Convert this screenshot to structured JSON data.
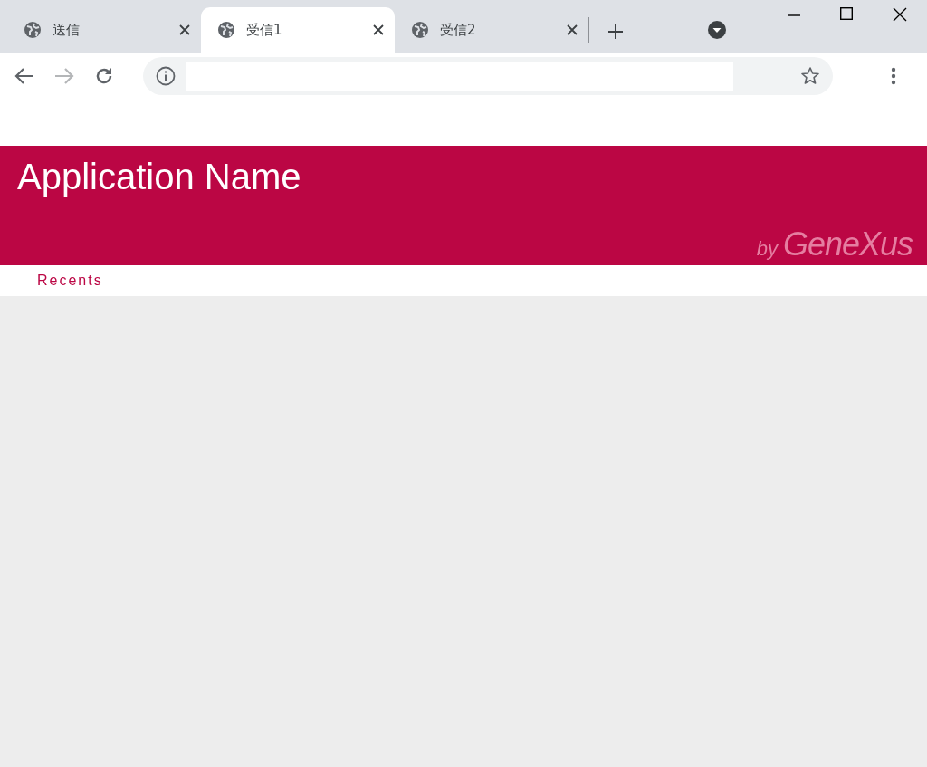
{
  "browser": {
    "tabs": [
      {
        "title": "送信",
        "selected": false
      },
      {
        "title": "受信1",
        "selected": true
      },
      {
        "title": "受信2",
        "selected": false
      }
    ],
    "toolbar": {
      "back_disabled": false,
      "forward_disabled": true
    }
  },
  "header": {
    "title": "Application Name",
    "logo_prefix": "by",
    "logo": "GeneXus"
  },
  "nav": {
    "items": [
      {
        "label": "Recents"
      }
    ]
  }
}
